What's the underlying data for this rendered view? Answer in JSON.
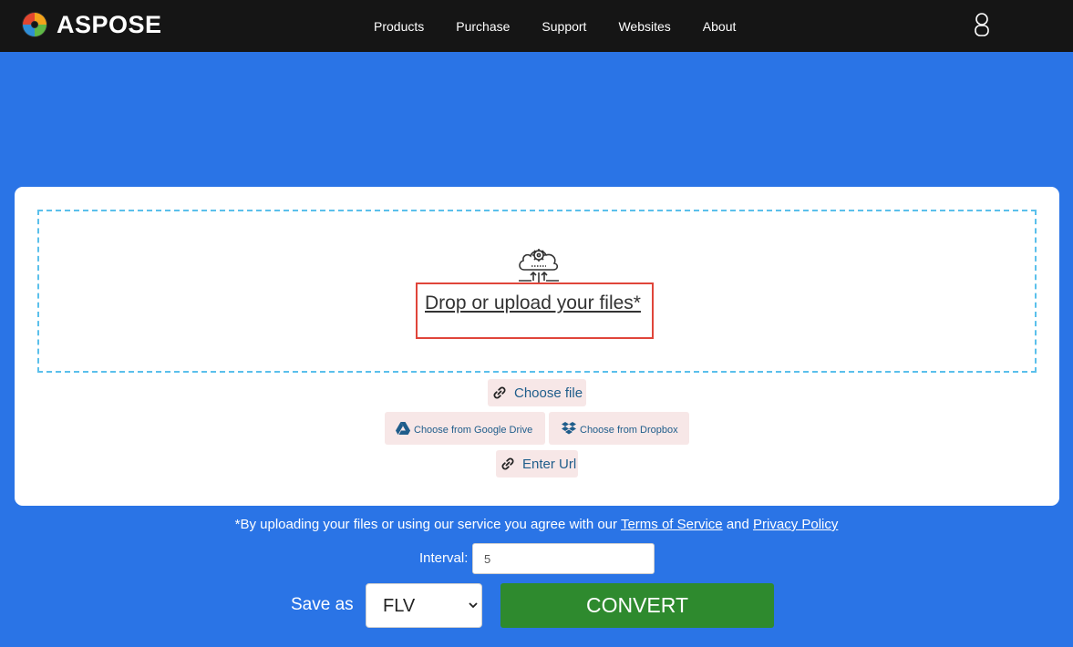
{
  "brand": {
    "name": "ASPOSE",
    "logo_icon": "aspose-swirl-logo"
  },
  "nav": {
    "items": [
      {
        "label": "Products"
      },
      {
        "label": "Purchase"
      },
      {
        "label": "Support"
      },
      {
        "label": "Websites"
      },
      {
        "label": "About"
      }
    ],
    "user_icon": "user-icon"
  },
  "upload": {
    "cloud_icon": "cloud-gear-upload-icon",
    "drop_text": "Drop or upload your files*",
    "choose_file": {
      "label": "Choose file",
      "icon": "paperclip-icon"
    },
    "google_drive": {
      "label": "Choose from Google Drive",
      "icon": "google-drive-icon"
    },
    "dropbox": {
      "label": "Choose from Dropbox",
      "icon": "dropbox-icon"
    },
    "enter_url": {
      "label": "Enter Url",
      "icon": "link-icon"
    }
  },
  "consent": {
    "prefix": "*By uploading your files or using our service you agree with our",
    "terms_link": "Terms of Service",
    "and": "and",
    "privacy_link": "Privacy Policy"
  },
  "interval": {
    "label": "Interval:",
    "value": "5"
  },
  "save": {
    "label": "Save as",
    "format": "FLV"
  },
  "convert": {
    "label": "CONVERT"
  },
  "colors": {
    "page_background": "#2a74e6",
    "navbar": "#151515",
    "dropzone_border": "#5bc0eb",
    "highlight_border": "#e0453a",
    "source_button_bg": "#f7e7e7",
    "source_button_text": "#1f5d8b",
    "convert_button": "#2e8a2e"
  }
}
